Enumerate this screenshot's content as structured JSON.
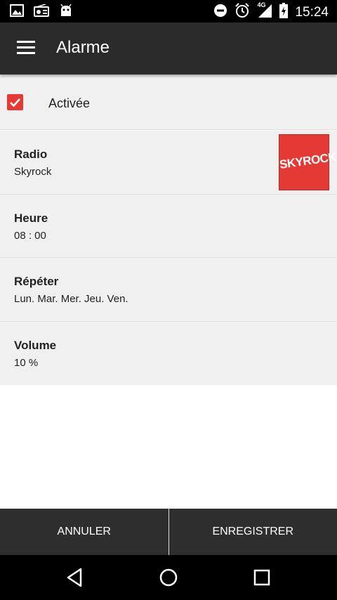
{
  "status_bar": {
    "time": "15:24",
    "network": "4G",
    "icons": [
      "image-icon",
      "radio-icon",
      "android-icon",
      "do-not-disturb-icon",
      "alarm-icon",
      "signal-icon",
      "battery-charging-icon"
    ]
  },
  "app_bar": {
    "title": "Alarme",
    "menu_icon": "hamburger-menu-icon"
  },
  "enabled": {
    "label": "Activée",
    "checked": true
  },
  "settings": {
    "radio": {
      "title": "Radio",
      "value": "Skyrock",
      "logo_text": "SKYROCK"
    },
    "time": {
      "title": "Heure",
      "value": "08 : 00"
    },
    "repeat": {
      "title": "Répéter",
      "value": "Lun. Mar. Mer. Jeu. Ven."
    },
    "volume": {
      "title": "Volume",
      "value": "10 %"
    }
  },
  "actions": {
    "cancel_label": "ANNULER",
    "save_label": "ENREGISTRER"
  },
  "colors": {
    "accent": "#e53935",
    "app_bar": "#2b2b2b",
    "row_background": "#f0f0f0"
  }
}
